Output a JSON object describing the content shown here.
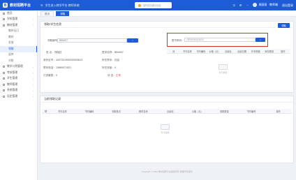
{
  "app": {
    "title": "教材招聘平台",
    "logo_glyph": "B"
  },
  "top_menu": [
    "☰",
    "学生进入教学平台 教师系统"
  ],
  "notice": {
    "text": "操作成功提示信息"
  },
  "user": {
    "links": [
      "⎋",
      "⚙",
      "⋯"
    ],
    "name": "周丽丽 · 教师端",
    "logout": "退出登录"
  },
  "sidebar": {
    "items": [
      {
        "label": "首页",
        "chev": "",
        "cls": "nav"
      },
      {
        "label": "学校管理",
        "chev": "⌄",
        "cls": "nav"
      },
      {
        "label": "教材管理",
        "chev": "⌃",
        "cls": "nav"
      },
      {
        "label": "教材征订",
        "chev": "",
        "cls": "nav sub"
      },
      {
        "label": "教材",
        "chev": "",
        "cls": "nav sub"
      },
      {
        "label": "发放",
        "chev": "",
        "cls": "nav sub"
      },
      {
        "label": "领取",
        "chev": "",
        "cls": "nav sub active"
      },
      {
        "label": "退库",
        "chev": "",
        "cls": "nav sub"
      },
      {
        "label": "对账",
        "chev": "",
        "cls": "nav sub"
      },
      {
        "label": "教学计划管理",
        "chev": "⌄",
        "cls": "nav"
      },
      {
        "label": "考核管理",
        "chev": "⌄",
        "cls": "nav"
      },
      {
        "label": "学生管理",
        "chev": "⌄",
        "cls": "nav"
      },
      {
        "label": "教师管理",
        "chev": "⌄",
        "cls": "nav"
      },
      {
        "label": "系统管理",
        "chev": "⌄",
        "cls": "nav"
      },
      {
        "label": "设定管理",
        "chev": "⌄",
        "cls": "nav"
      }
    ]
  },
  "tabs": [
    {
      "label": "首页"
    },
    {
      "label": "领取"
    }
  ],
  "info_panel": {
    "title": "领取/学生信息",
    "code_label": "领取编号：",
    "code_value": "BB4007",
    "rows": [
      {
        "k1": "姓  名：",
        "v1": "刘晓红",
        "k2": "登录名称：",
        "v2": "BB4007"
      },
      {
        "k1": "身份证号：",
        "v1": "4407321990030503613",
        "k2": "所在院系：",
        "v2": "社会"
      },
      {
        "k1": "联系电话：",
        "v1": "13660071521",
        "k2": "所在班级：",
        "v2": "4"
      },
      {
        "k1": "已领套数：",
        "v1": "0",
        "k2": "状  态：",
        "v2": "正常"
      }
    ]
  },
  "materials_panel": {
    "button": "领取",
    "label": "图书条码：",
    "value": "JJR0204343434",
    "columns": [
      "序",
      "书刊名称",
      "书刊编码",
      "价格（元）",
      "出版社",
      "出版日期",
      "开本规格",
      "库存数量",
      "操作"
    ],
    "empty": "暂无数据"
  },
  "history_panel": {
    "title": "当前领取记录",
    "columns": [
      "书刊名称",
      "书刊编码",
      "领取批次",
      "教材名称",
      "出版社",
      "价格（元）",
      "领取数量",
      "书刊编号",
      "操作"
    ],
    "empty": "暂无数据"
  },
  "footer": "Copyright © 2022 教材招聘平台版权所有 保留所有权利"
}
